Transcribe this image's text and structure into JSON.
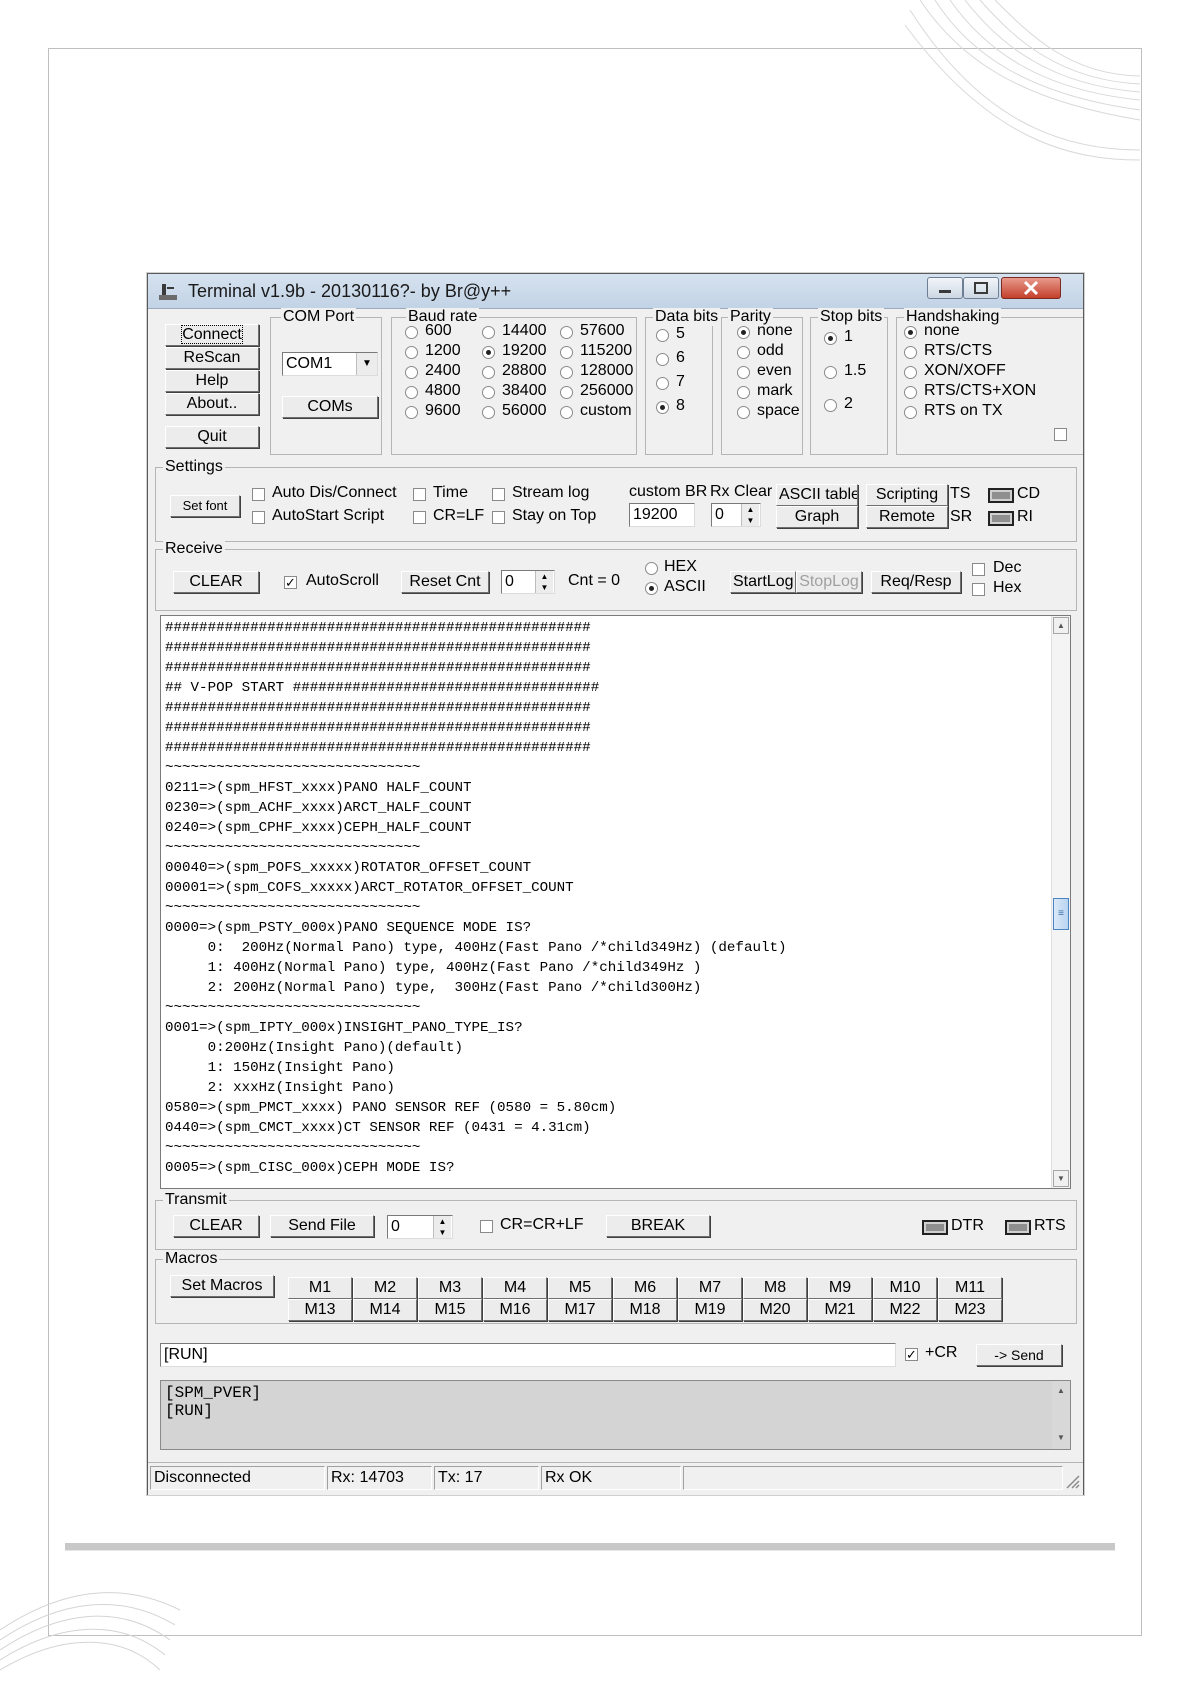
{
  "window": {
    "title": "Terminal v1.9b - 20130116?- by Br@y++"
  },
  "left_buttons": {
    "connect": "Connect",
    "rescan": "ReScan",
    "help": "Help",
    "about": "About..",
    "quit": "Quit"
  },
  "com_port": {
    "label": "COM Port",
    "selected": "COM1",
    "coms_button": "COMs"
  },
  "baud_rate": {
    "label": "Baud rate",
    "options": [
      "600",
      "1200",
      "2400",
      "4800",
      "9600",
      "14400",
      "19200",
      "28800",
      "38400",
      "56000",
      "57600",
      "115200",
      "128000",
      "256000",
      "custom"
    ],
    "selected": "19200"
  },
  "data_bits": {
    "label": "Data bits",
    "options": [
      "5",
      "6",
      "7",
      "8"
    ],
    "selected": "8"
  },
  "parity": {
    "label": "Parity",
    "options": [
      "none",
      "odd",
      "even",
      "mark",
      "space"
    ],
    "selected": "none"
  },
  "stop_bits": {
    "label": "Stop bits",
    "options": [
      "1",
      "1.5",
      "2"
    ],
    "selected": "1"
  },
  "handshaking": {
    "label": "Handshaking",
    "options": [
      "none",
      "RTS/CTS",
      "XON/XOFF",
      "RTS/CTS+XON",
      "RTS on TX"
    ],
    "selected": "none"
  },
  "settings": {
    "label": "Settings",
    "set_font": "Set font",
    "auto_dis_connect": "Auto Dis/Connect",
    "autostart_script": "AutoStart Script",
    "time": "Time",
    "cr_lf": "CR=LF",
    "stream_log": "Stream log",
    "stay_on_top": "Stay on Top",
    "custom_br_label": "custom BR",
    "custom_br_value": "19200",
    "rx_clear_label": "Rx Clear",
    "rx_clear_value": "0",
    "ascii_table": "ASCII table",
    "graph": "Graph",
    "scripting": "Scripting",
    "remote": "Remote",
    "ts": "TS",
    "sr": "SR",
    "cd": "CD",
    "ri": "RI"
  },
  "receive": {
    "label": "Receive",
    "clear": "CLEAR",
    "autoscroll": "AutoScroll",
    "autoscroll_checked": true,
    "reset_cnt": "Reset Cnt",
    "cnt_spin": "0",
    "cnt_text": "Cnt = 0",
    "hex": "HEX",
    "ascii": "ASCII",
    "mode_selected": "ASCII",
    "startlog": "StartLog",
    "stoplog": "StopLog",
    "req_resp": "Req/Resp",
    "dec": "Dec",
    "hex_chk": "Hex",
    "output": "##################################################\n##################################################\n##################################################\n## V-POP START ####################################\n##################################################\n##################################################\n##################################################\n~~~~~~~~~~~~~~~~~~~~~~~~~~~~~~\n0211=>(spm_HFST_xxxx)PANO HALF_COUNT\n0230=>(spm_ACHF_xxxx)ARCT_HALF_COUNT\n0240=>(spm_CPHF_xxxx)CEPH_HALF_COUNT\n~~~~~~~~~~~~~~~~~~~~~~~~~~~~~~\n00040=>(spm_POFS_xxxxx)ROTATOR_OFFSET_COUNT\n00001=>(spm_COFS_xxxxx)ARCT_ROTATOR_OFFSET_COUNT\n~~~~~~~~~~~~~~~~~~~~~~~~~~~~~~\n0000=>(spm_PSTY_000x)PANO SEQUENCE MODE IS?\n     0:  200Hz(Normal Pano) type, 400Hz(Fast Pano /*child349Hz) (default)\n     1: 400Hz(Normal Pano) type, 400Hz(Fast Pano /*child349Hz )\n     2: 200Hz(Normal Pano) type,  300Hz(Fast Pano /*child300Hz)\n~~~~~~~~~~~~~~~~~~~~~~~~~~~~~~\n0001=>(spm_IPTY_000x)INSIGHT_PANO_TYPE_IS?\n     0:200Hz(Insight Pano)(default)\n     1: 150Hz(Insight Pano)\n     2: xxxHz(Insight Pano)\n0580=>(spm_PMCT_xxxx) PANO SENSOR REF (0580 = 5.80cm)\n0440=>(spm_CMCT_xxxx)CT SENSOR REF (0431 = 4.31cm)\n~~~~~~~~~~~~~~~~~~~~~~~~~~~~~~\n0005=>(spm_CISC_000x)CEPH MODE IS?"
  },
  "transmit": {
    "label": "Transmit",
    "clear": "CLEAR",
    "send_file": "Send File",
    "spin": "0",
    "cr_crlf": "CR=CR+LF",
    "break": "BREAK",
    "dtr": "DTR",
    "rts": "RTS"
  },
  "macros": {
    "label": "Macros",
    "set_macros": "Set Macros",
    "row1": [
      "M1",
      "M2",
      "M3",
      "M4",
      "M5",
      "M6",
      "M7",
      "M8",
      "M9",
      "M10",
      "M11"
    ],
    "row2": [
      "M13",
      "M14",
      "M15",
      "M16",
      "M17",
      "M18",
      "M19",
      "M20",
      "M21",
      "M22",
      "M23"
    ]
  },
  "send": {
    "input_value": "[RUN]",
    "plus_cr": "+CR",
    "plus_cr_checked": true,
    "send_button": "-> Send"
  },
  "history": "[SPM_PVER]\n[RUN]",
  "status": {
    "connection": "Disconnected",
    "rx": "Rx: 14703",
    "tx": "Tx: 17",
    "rx_ok": "Rx OK"
  }
}
